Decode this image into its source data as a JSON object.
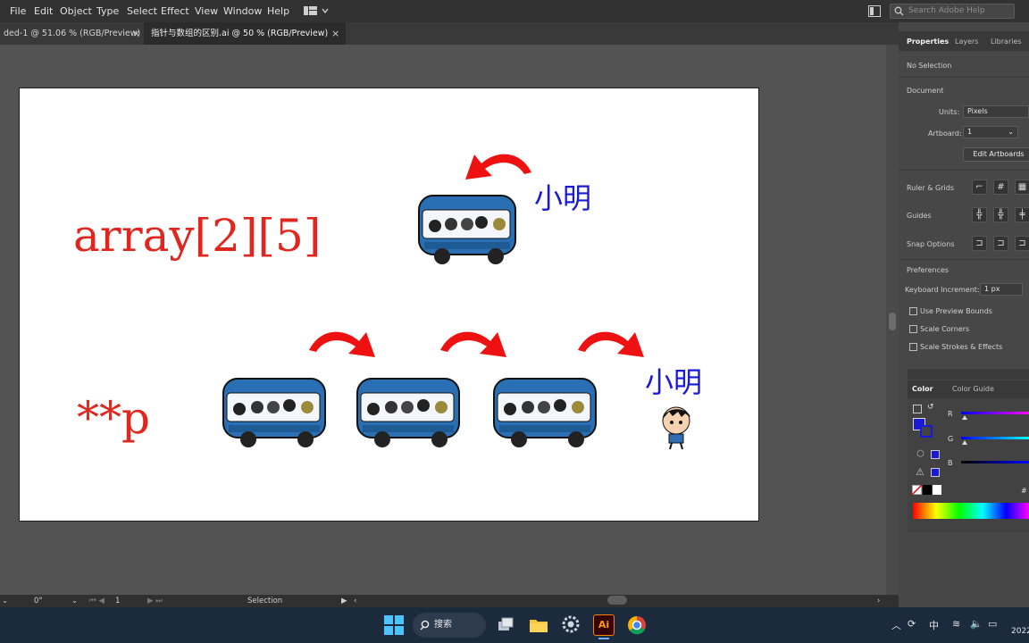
{
  "menu": {
    "items": [
      "File",
      "Edit",
      "Object",
      "Type",
      "Select",
      "Effect",
      "View",
      "Window",
      "Help"
    ],
    "search_placeholder": "Search Adobe Help"
  },
  "tabs": [
    {
      "label": "ded-1 @ 51.06 % (RGB/Preview)",
      "close": "×"
    },
    {
      "label": "指针与数组的区别.ai @ 50 % (RGB/Preview)",
      "close": "×"
    }
  ],
  "artboard": {
    "array_text": "array[2][5]",
    "pointer_text": "**p",
    "name_top": "小明",
    "name_bottom": "小明",
    "colors": {
      "red": "#e0261e",
      "blue": "#1a1ad6",
      "arrow": "#ee1111"
    }
  },
  "status": {
    "rotation": "0°",
    "artboard_num": "1",
    "tool": "Selection"
  },
  "panel": {
    "tabs": [
      "Properties",
      "Layers",
      "Libraries"
    ],
    "no_selection": "No Selection",
    "document_label": "Document",
    "units_label": "Units:",
    "units_value": "Pixels",
    "artboard_label": "Artboard:",
    "artboard_value": "1",
    "edit_artboards": "Edit Artboards",
    "ruler_grids": "Ruler & Grids",
    "guides": "Guides",
    "snap_options": "Snap Options",
    "preferences": "Preferences",
    "keyboard_increment_label": "Keyboard Increment:",
    "keyboard_increment_value": "1 px",
    "checkboxes": [
      "Use Preview Bounds",
      "Scale Corners",
      "Scale Strokes & Effects"
    ],
    "color_tabs": [
      "Color",
      "Color Guide"
    ],
    "channels": [
      "R",
      "G",
      "B"
    ],
    "hash": "#"
  },
  "taskbar": {
    "search_label": "搜索",
    "ime": "中",
    "year": "2022"
  }
}
